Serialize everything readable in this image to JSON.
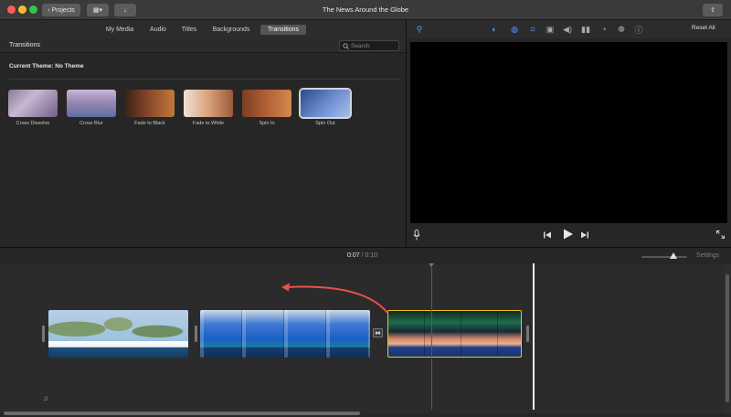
{
  "window": {
    "title": "The News Around the Globe",
    "projects_label": "Projects"
  },
  "browser": {
    "tabs": [
      "My Media",
      "Audio",
      "Titles",
      "Backgrounds",
      "Transitions"
    ],
    "active_tab": "Transitions"
  },
  "transitions_panel": {
    "title": "Transitions",
    "search_placeholder": "Search",
    "theme_label": "Current Theme: No Theme",
    "items": [
      {
        "label": "Cross Dissolve"
      },
      {
        "label": "Cross Blur"
      },
      {
        "label": "Fade to Black"
      },
      {
        "label": "Fade to White"
      },
      {
        "label": "Spin In"
      },
      {
        "label": "Spin Out"
      }
    ],
    "selected": "Spin Out"
  },
  "viewer": {
    "reset_all": "Reset All"
  },
  "timeline": {
    "current_time": "0:07",
    "separator": "/",
    "duration": "0:10",
    "settings_label": "Settings",
    "zoom_level": 0.7
  },
  "colors": {
    "accent": "#4a9fff",
    "clip_selected_border": "#f2c41b",
    "annotation_arrow": "#e8514a"
  }
}
